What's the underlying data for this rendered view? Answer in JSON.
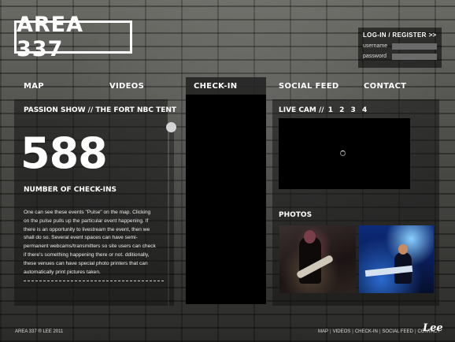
{
  "logo": {
    "text": "AREA 337"
  },
  "login": {
    "heading": "LOG-IN / REGISTER",
    "go": ">>",
    "username_label": "username",
    "password_label": "password"
  },
  "nav": {
    "map": "MAP",
    "videos": "VIDEOS",
    "checkin": "CHECK-IN",
    "social": "SOCIAL FEED",
    "contact": "CONTACT"
  },
  "event": {
    "title": "PASSION SHOW // THE FORT NBC TENT",
    "count": "588",
    "count_label": "NUMBER OF CHECK-INS",
    "description": "One can see these events \"Pulse\" on the map. Clicking on the pulse pulls up the particular event happening. If there is an opportunity to livestream the event, then we shall do so. Several event spaces can have semi-permanent webcams/transmitters so site users can  check if there's something happening there or not. dditionally, these venues can have special photo printers that can automatically print pictures taken."
  },
  "livecam": {
    "title": "LIVE CAM //",
    "cams": [
      "1",
      "2",
      "3",
      "4"
    ]
  },
  "photos": {
    "title": "PHOTOS"
  },
  "footer": {
    "copyright": "AREA 337 ® LEE 2011",
    "links": [
      "MAP",
      "VIDEOS",
      "CHECK-IN",
      "SOCIAL FEED",
      "CONTACT"
    ],
    "brand": "Lee"
  }
}
